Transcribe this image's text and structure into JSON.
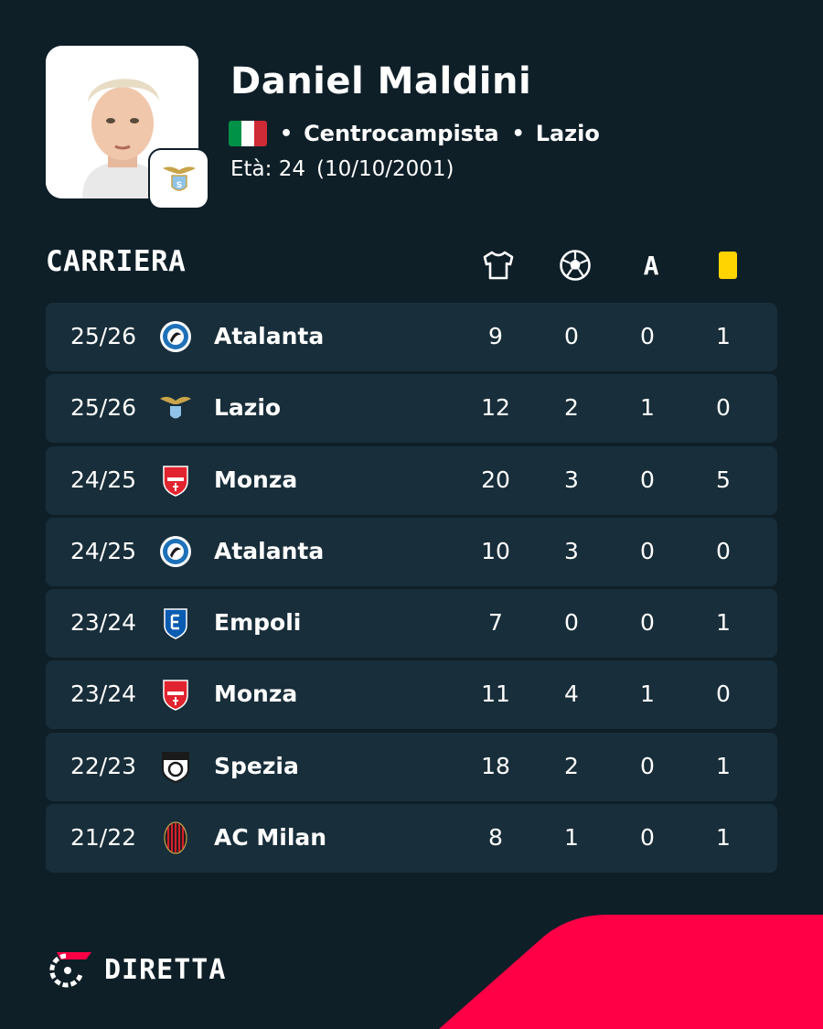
{
  "player": {
    "name": "Daniel Maldini",
    "position": "Centrocampista",
    "club": "Lazio",
    "age_label": "Età: 24",
    "birth_date": "(10/10/2001)",
    "nationality_flag_colors": [
      "#009246",
      "#ffffff",
      "#ce2b37"
    ]
  },
  "career": {
    "title": "CARRIERA",
    "column_icons": [
      "jersey-icon",
      "ball-icon",
      "assist-letter",
      "yellow-card-icon"
    ],
    "assist_letter": "A",
    "rows": [
      {
        "season": "25/26",
        "team": "Atalanta",
        "apps": "9",
        "goals": "0",
        "assists": "0",
        "yellow": "1"
      },
      {
        "season": "25/26",
        "team": "Lazio",
        "apps": "12",
        "goals": "2",
        "assists": "1",
        "yellow": "0"
      },
      {
        "season": "24/25",
        "team": "Monza",
        "apps": "20",
        "goals": "3",
        "assists": "0",
        "yellow": "5"
      },
      {
        "season": "24/25",
        "team": "Atalanta",
        "apps": "10",
        "goals": "3",
        "assists": "0",
        "yellow": "0"
      },
      {
        "season": "23/24",
        "team": "Empoli",
        "apps": "7",
        "goals": "0",
        "assists": "0",
        "yellow": "1"
      },
      {
        "season": "23/24",
        "team": "Monza",
        "apps": "11",
        "goals": "4",
        "assists": "1",
        "yellow": "0"
      },
      {
        "season": "22/23",
        "team": "Spezia",
        "apps": "18",
        "goals": "2",
        "assists": "0",
        "yellow": "1"
      },
      {
        "season": "21/22",
        "team": "AC Milan",
        "apps": "8",
        "goals": "1",
        "assists": "0",
        "yellow": "1"
      }
    ]
  },
  "brand": {
    "name": "DIRETTA",
    "accent_color": "#ff0046",
    "card_color": "#ffd400"
  }
}
